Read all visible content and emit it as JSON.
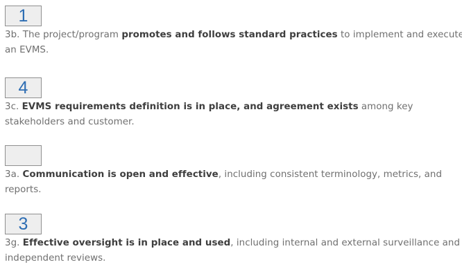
{
  "items": [
    {
      "score": "1",
      "code": "3b.",
      "pre": " The project/program ",
      "bold": "promotes and follows standard practices",
      "post": " to implement and execute an EVMS."
    },
    {
      "score": "4",
      "code": "3c.",
      "pre": " ",
      "bold": "EVMS requirements definition is in place, and agreement exists",
      "post": " among key stakeholders and customer."
    },
    {
      "score": "",
      "code": "3a.",
      "pre": " ",
      "bold": "Communication is open and effective",
      "post": ", including consistent terminology, metrics, and reports."
    },
    {
      "score": "3",
      "code": "3g.",
      "pre": " ",
      "bold": "Effective oversight is in place and used",
      "post": ", including internal and external surveillance and independent reviews."
    }
  ]
}
